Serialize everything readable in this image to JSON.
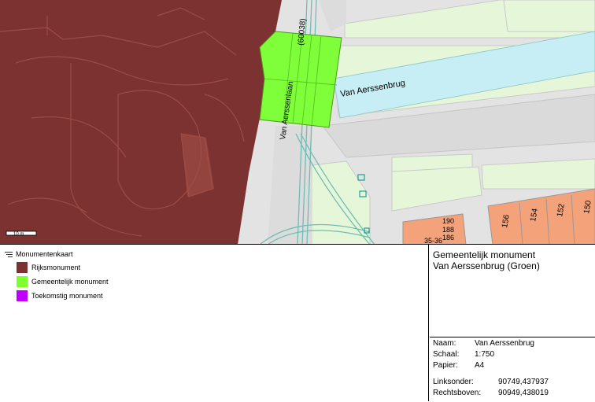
{
  "map": {
    "labels": {
      "bridge_name": "Van Aerssenbrug",
      "street_name": "Van Aerssenlaan",
      "road_code": "(60038)",
      "house_numbers": [
        "190",
        "188",
        "186",
        "35-36",
        "156",
        "154",
        "152",
        "150"
      ]
    },
    "scale_bar_label": "10 m",
    "colors": {
      "rijksmonument": "#7b3230",
      "gemeentelijk": "#7fff3a",
      "water": "#c8eef5",
      "green": "#e6f7d9",
      "road": "#e0e0e0",
      "building_orange": "#f4a27a",
      "tram": "#6fbdb2"
    }
  },
  "legend": {
    "title": "Monumentenkaart",
    "items": [
      {
        "label": "Rijksmonument",
        "color": "#7b3230"
      },
      {
        "label": "Gemeentelijk monument",
        "color": "#80ff2e"
      },
      {
        "label": "Toekomstig monument",
        "color": "#c000ff"
      }
    ]
  },
  "info": {
    "title_line1": "Gemeentelijk monument",
    "title_line2": "Van Aerssenbrug (Groen)",
    "naam_label": "Naam:",
    "naam_value": "Van Aerssenbrug",
    "schaal_label": "Schaal:",
    "schaal_value": "1:750",
    "papier_label": "Papier:",
    "papier_value": "A4",
    "linksonder_label": "Linksonder:",
    "linksonder_value": "90749,437937",
    "rechtsboven_label": "Rechtsboven:",
    "rechtsboven_value": "90949,438019"
  }
}
